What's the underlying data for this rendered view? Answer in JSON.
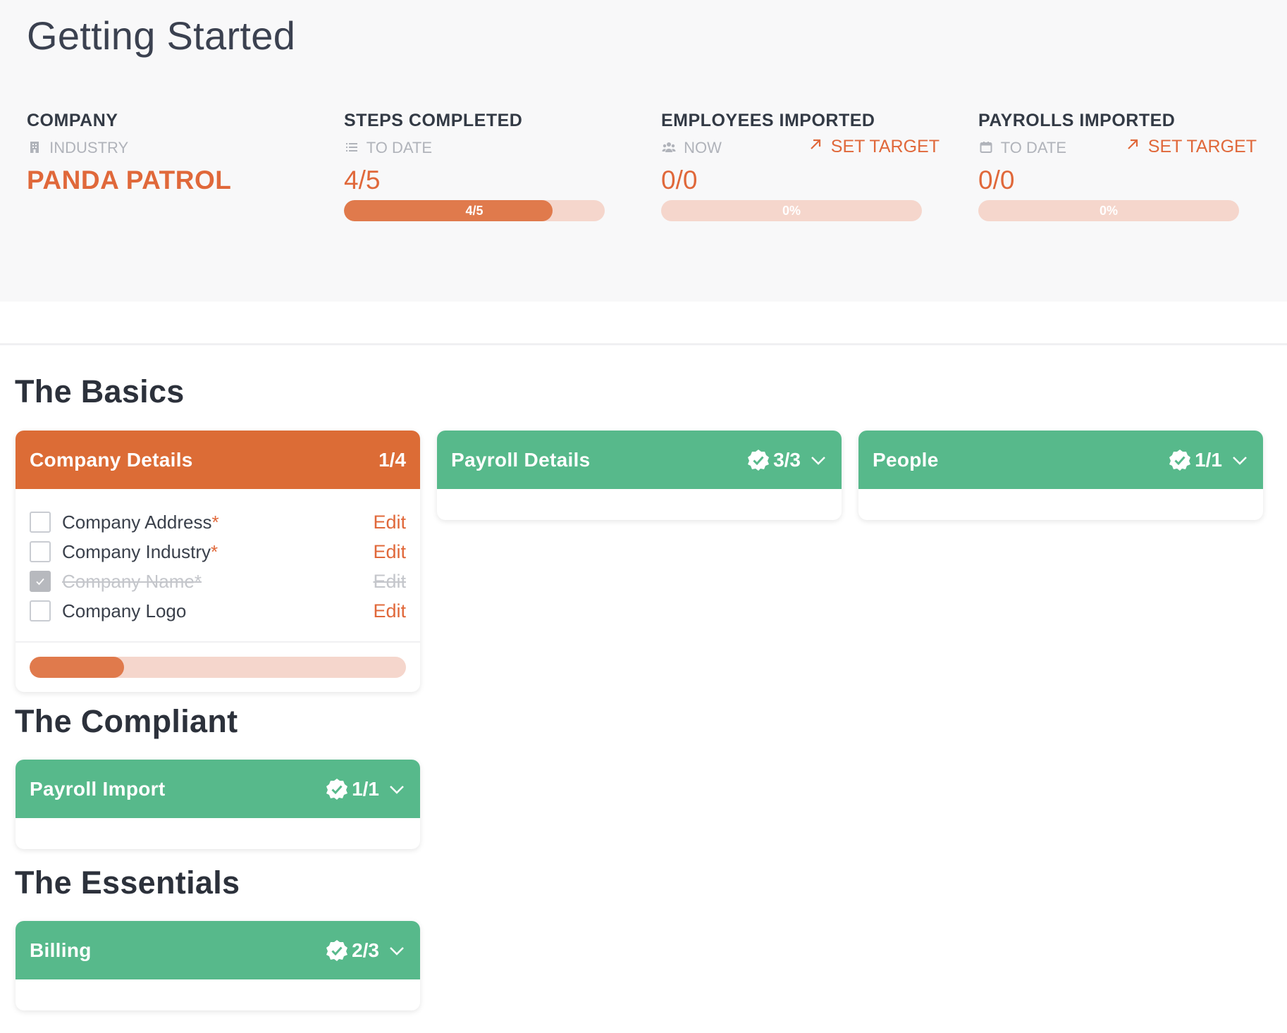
{
  "page": {
    "title": "Getting Started"
  },
  "stats": {
    "company": {
      "label": "COMPANY",
      "sub": "INDUSTRY",
      "value": "PANDA PATROL"
    },
    "steps": {
      "label": "STEPS COMPLETED",
      "sub": "TO DATE",
      "value": "4/5",
      "progress_label": "4/5",
      "progress": 0.8
    },
    "employees": {
      "label": "EMPLOYEES IMPORTED",
      "sub": "NOW",
      "target": "SET TARGET",
      "value": "0/0",
      "progress_label": "0%",
      "progress": 0
    },
    "payrolls": {
      "label": "PAYROLLS IMPORTED",
      "sub": "TO DATE",
      "target": "SET TARGET",
      "value": "0/0",
      "progress_label": "0%",
      "progress": 0
    }
  },
  "sections": {
    "basics": {
      "title": "The Basics",
      "company_details": {
        "title": "Company Details",
        "count": "1/4",
        "progress": 0.25,
        "tasks": [
          {
            "label": "Company Address",
            "required": "*",
            "edit": "Edit",
            "done": false
          },
          {
            "label": "Company Industry",
            "required": "*",
            "edit": "Edit",
            "done": false
          },
          {
            "label": "Company Name",
            "required": "*",
            "edit": "Edit",
            "done": true
          },
          {
            "label": "Company Logo",
            "required": "",
            "edit": "Edit",
            "done": false
          }
        ]
      },
      "payroll_details": {
        "title": "Payroll Details",
        "count": "3/3"
      },
      "people": {
        "title": "People",
        "count": "1/1"
      }
    },
    "compliant": {
      "title": "The Compliant",
      "payroll_import": {
        "title": "Payroll Import",
        "count": "1/1"
      }
    },
    "essentials": {
      "title": "The Essentials",
      "billing": {
        "title": "Billing",
        "count": "2/3"
      }
    }
  },
  "colors": {
    "accent": "#e0683a",
    "card_orange": "#dc6c36",
    "card_green": "#57b98b",
    "progress_track": "#f5d6cc"
  },
  "icons": {
    "industry": "building-icon",
    "steps": "list-icon",
    "employees": "users-icon",
    "payrolls": "calendar-icon",
    "target": "arrow-up-right-icon",
    "complete": "check-badge-icon",
    "expand": "chevron-down-icon"
  }
}
